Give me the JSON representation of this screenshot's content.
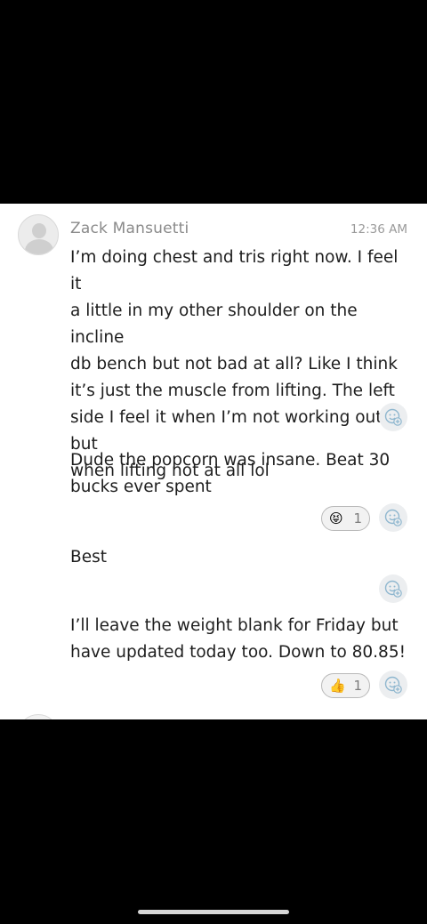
{
  "thread": {
    "sender_name": "Zack Mansuetti",
    "timestamp": "12:36 AM"
  },
  "messages": [
    {
      "text": "I’m doing chest and tris right now. I feel it\na little in my other shoulder on the incline\ndb bench but not bad at all? Like I think\nit’s just the muscle from lifting. The left\nside I feel it when I’m not working out but\nwhen lifting not at all lol",
      "reaction": null
    },
    {
      "text": "Dude the popcorn was insane. Beat 30\nbucks ever spent",
      "reaction": {
        "emoji": "😝",
        "count": "1"
      }
    },
    {
      "text": "Best",
      "reaction": null
    },
    {
      "text": "I’ll leave the weight blank for Friday but\nhave updated today too. Down to 80.85!",
      "reaction": {
        "emoji": "👍",
        "count": "1"
      }
    }
  ],
  "icons": {
    "add_reaction": "add-reaction-icon",
    "avatar": "user-avatar-placeholder"
  },
  "colors": {
    "background": "#000000",
    "panel": "#ffffff",
    "text": "#1e1e1e",
    "muted": "#8a8a8a",
    "reaction_bg": "#eceef0",
    "reaction_icon": "#8fb7cf"
  }
}
